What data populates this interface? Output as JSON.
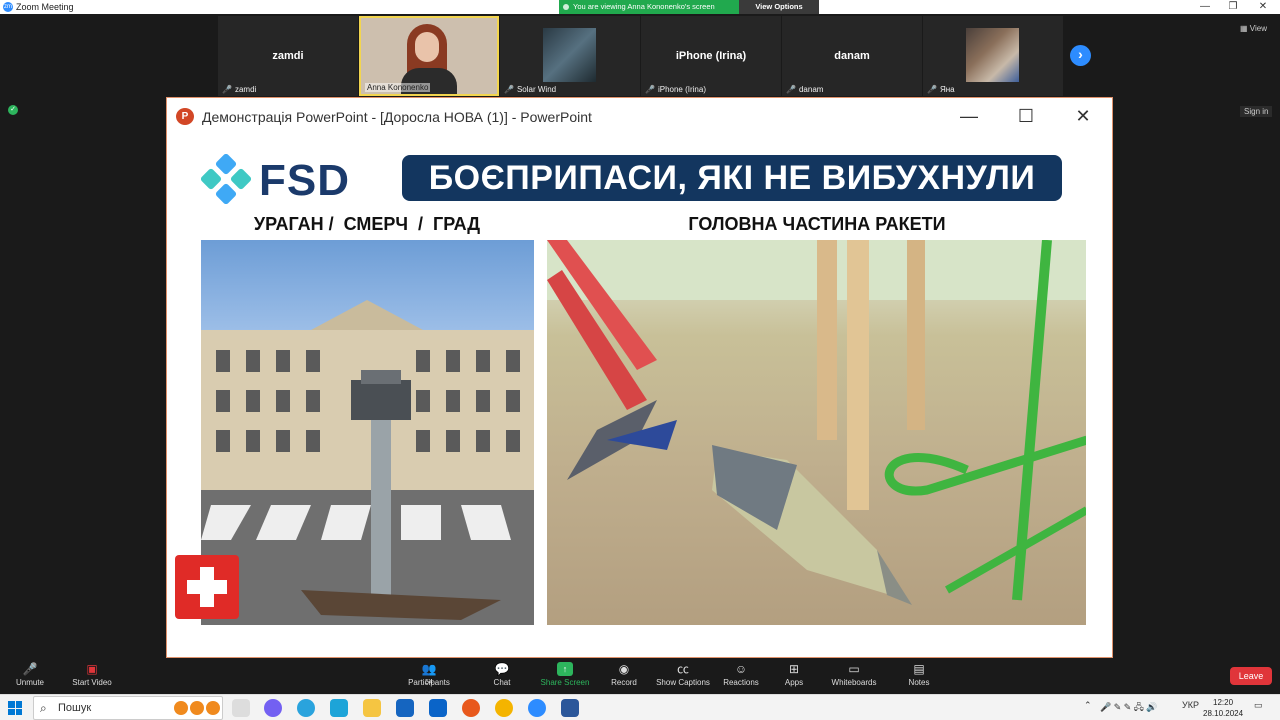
{
  "app": {
    "title": "Zoom Meeting",
    "logo_text": "zm"
  },
  "window_controls": [
    "—",
    "❐",
    "✕"
  ],
  "share_banner": {
    "text": "You are viewing Anna Kononenko's screen",
    "view_options": "View Options"
  },
  "participants_strip": [
    {
      "big": "zamdi",
      "small": "zamdi",
      "type": "name"
    },
    {
      "big": "",
      "small": "Anna Kononenko",
      "type": "video"
    },
    {
      "big": "",
      "small": "Solar Wind",
      "type": "image-solar"
    },
    {
      "big": "iPhone (Irina)",
      "small": "iPhone (Irina)",
      "type": "name"
    },
    {
      "big": "danam",
      "small": "danam",
      "type": "name"
    },
    {
      "big": "",
      "small": "Яна",
      "type": "image-cat"
    }
  ],
  "right_controls": {
    "view": "▦ View",
    "signin": "Sign in"
  },
  "ppt": {
    "icon_letter": "P",
    "title": "Демонстрація PowerPoint - [Доросла НОВА (1)] - PowerPoint",
    "controls": {
      "minimize": "—",
      "maximize": "☐",
      "close": "✕"
    }
  },
  "slide": {
    "logo_text": "FSD",
    "banner": "БОЄПРИПАСИ, ЯКІ НЕ ВИБУХНУЛИ",
    "left_heading": "УРАГАН /  СМЕРЧ  /  ГРАД",
    "right_heading": "ГОЛОВНА ЧАСТИНА РАКЕТИ"
  },
  "toolbar": {
    "unmute": "Unmute",
    "start_video": "Start Video",
    "participants": "Participants",
    "participants_count": "54",
    "chat": "Chat",
    "share_screen": "Share Screen",
    "record": "Record",
    "captions": "Show Captions",
    "reactions": "Reactions",
    "apps": "Apps",
    "whiteboards": "Whiteboards",
    "notes": "Notes",
    "leave": "Leave"
  },
  "taskbar": {
    "search_placeholder": "Пошук",
    "lang": "УКР",
    "time": "12:20",
    "date": "28.10.2024"
  }
}
